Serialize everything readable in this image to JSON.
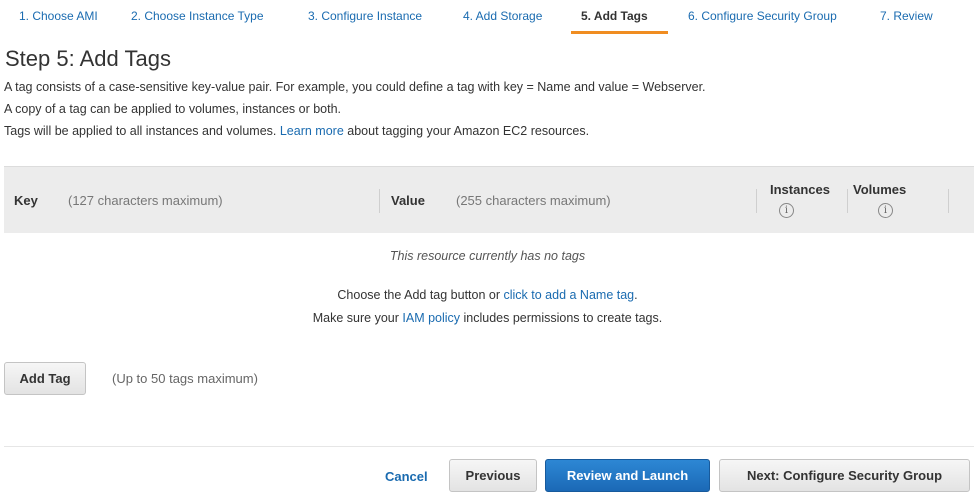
{
  "wizard": {
    "steps": [
      {
        "label": "1. Choose AMI"
      },
      {
        "label": "2. Choose Instance Type"
      },
      {
        "label": "3. Configure Instance"
      },
      {
        "label": "4. Add Storage"
      },
      {
        "label": "5. Add Tags"
      },
      {
        "label": "6. Configure Security Group"
      },
      {
        "label": "7. Review"
      }
    ],
    "active_step": "5. Add Tags",
    "accent_color": "#f08d21"
  },
  "page": {
    "title": "Step 5: Add Tags",
    "desc_line1": "A tag consists of a case-sensitive key-value pair. For example, you could define a tag with key = Name and value = Webserver.",
    "desc_line2": "A copy of a tag can be applied to volumes, instances or both.",
    "desc_line3_pre": "Tags will be applied to all instances and volumes. ",
    "desc_line3_link": "Learn more",
    "desc_line3_post": " about tagging your Amazon EC2 resources."
  },
  "table": {
    "key_label": "Key",
    "key_hint": "(127 characters maximum)",
    "value_label": "Value",
    "value_hint": "(255 characters maximum)",
    "instances_label": "Instances",
    "volumes_label": "Volumes",
    "info_glyph": "i",
    "empty_message": "This resource currently has no tags",
    "hint1_pre": "Choose the Add tag button or ",
    "hint1_link": "click to add a Name tag",
    "hint1_post": ".",
    "hint2_pre": "Make sure your ",
    "hint2_link": "IAM policy",
    "hint2_post": " includes permissions to create tags."
  },
  "add_tag": {
    "button_label": "Add Tag",
    "limit_text": "(Up to 50 tags maximum)"
  },
  "footer": {
    "cancel_label": "Cancel",
    "previous_label": "Previous",
    "review_label": "Review and Launch",
    "next_label": "Next: Configure Security Group",
    "primary_color": "#1b69b6"
  }
}
